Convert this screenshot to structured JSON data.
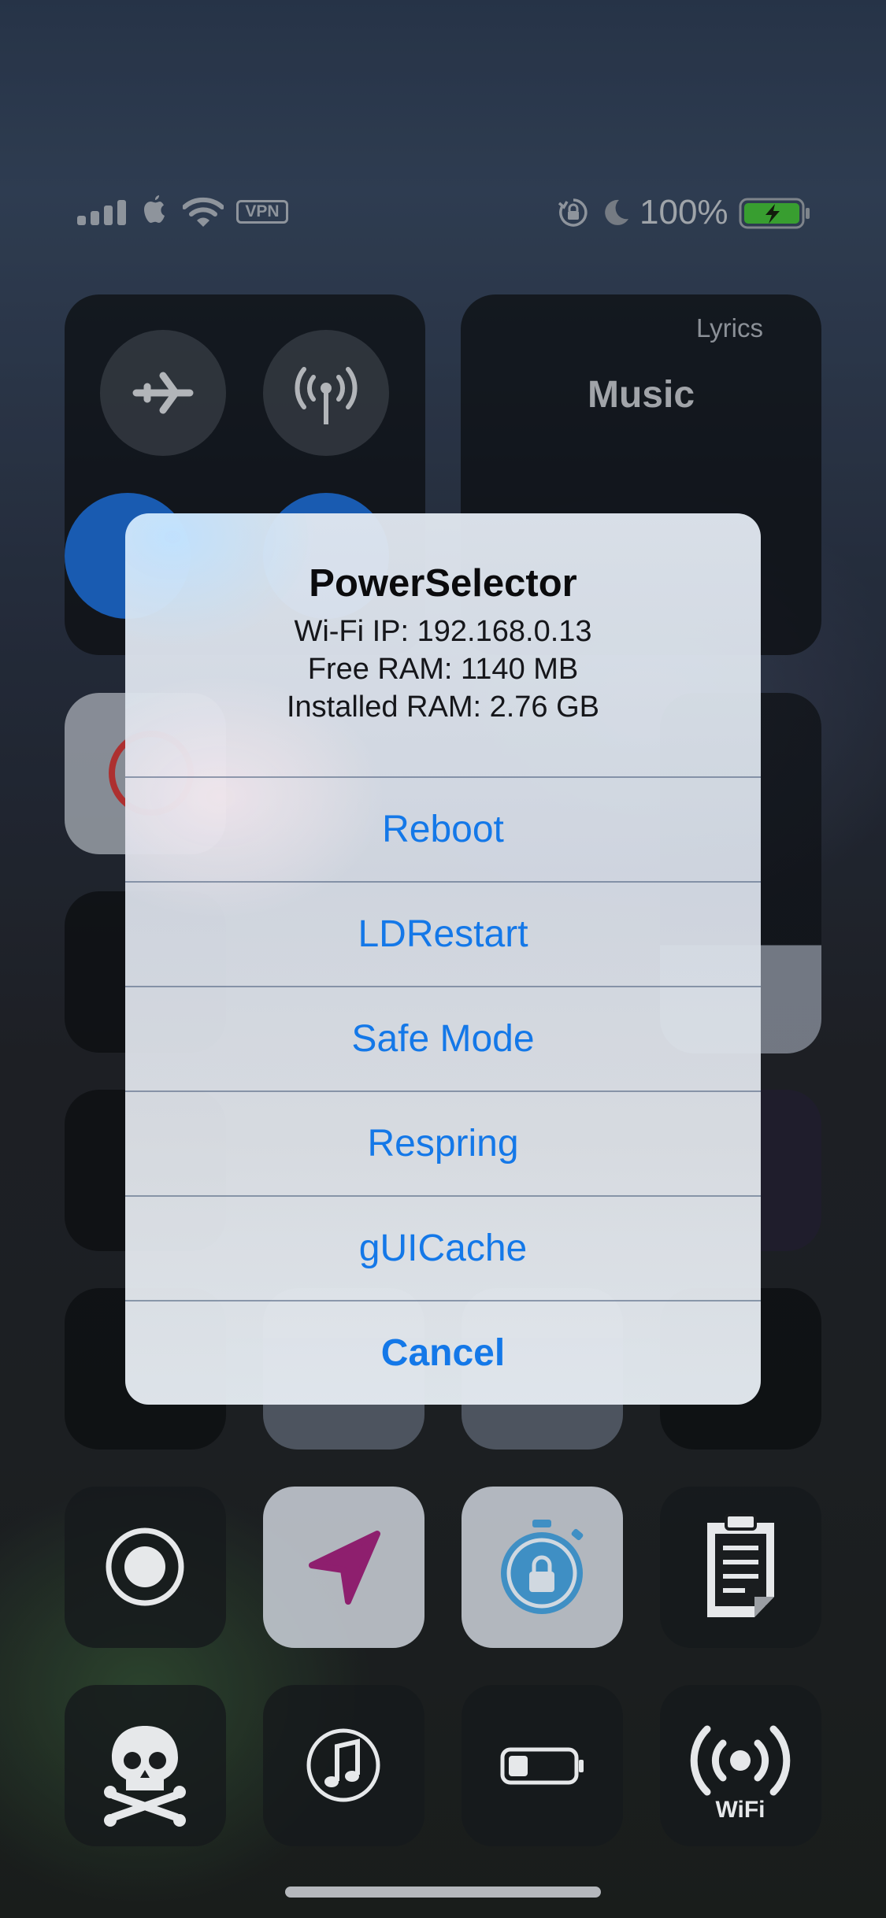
{
  "status_bar": {
    "vpn_label": "VPN",
    "battery_percent": "100%",
    "battery_level_percent": 100,
    "battery_color": "#45c13b",
    "icons": [
      "cellular-signal-icon",
      "apple-icon",
      "wifi-icon",
      "vpn-badge",
      "rotation-lock-icon",
      "moon-icon",
      "battery-charging-icon"
    ]
  },
  "control_center": {
    "music": {
      "lyrics_label": "Lyrics",
      "title": "Music"
    },
    "connectivity_icons": [
      "airplane-icon",
      "cellular-data-icon",
      "wifi-toggle",
      "bluetooth-toggle"
    ],
    "bottom_row_1_icons": [
      "screen-record-icon",
      "location-arrow-icon",
      "stopwatch-lock-icon",
      "clipboard-icon"
    ],
    "bottom_row_2_icons": [
      "skull-crossbones-icon",
      "music-note-icon",
      "battery-low-icon",
      "wifi-broadcast-icon"
    ],
    "wifi_tile_label": "WiFi"
  },
  "dialog": {
    "title": "PowerSelector",
    "message": {
      "wifi_ip": "Wi-Fi IP: 192.168.0.13",
      "free_ram": "Free RAM: 1140 MB",
      "installed_ram": "Installed RAM: 2.76 GB"
    },
    "actions": [
      {
        "label": "Reboot"
      },
      {
        "label": "LDRestart"
      },
      {
        "label": "Safe Mode"
      },
      {
        "label": "Respring"
      },
      {
        "label": "gUICache"
      }
    ],
    "cancel_label": "Cancel",
    "accent_color": "#1478e8"
  }
}
